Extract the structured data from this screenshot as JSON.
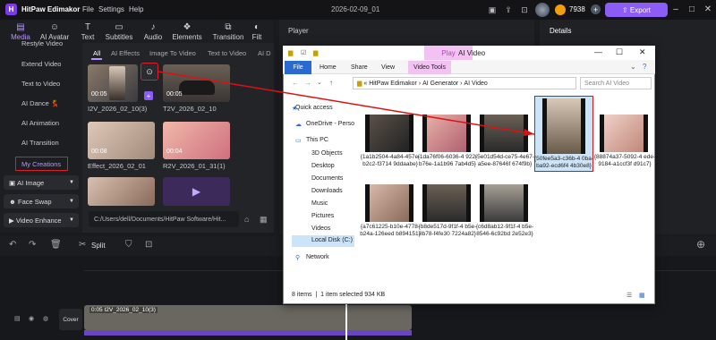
{
  "app": {
    "name": "HitPaw Edimakor",
    "menus": [
      "File",
      "Settings",
      "Help"
    ],
    "project": "2026-02-09_01",
    "coins": "7938",
    "export_label": "Export",
    "accent": "#8b5cf6"
  },
  "toolbar": {
    "items": [
      {
        "label": "Media",
        "icon": "media-icon"
      },
      {
        "label": "AI Avatar",
        "icon": "ai-avatar-icon"
      },
      {
        "label": "Text",
        "icon": "text-icon"
      },
      {
        "label": "Subtitles",
        "icon": "subtitles-icon"
      },
      {
        "label": "Audio",
        "icon": "audio-icon"
      },
      {
        "label": "Elements",
        "icon": "elements-icon"
      },
      {
        "label": "Transition",
        "icon": "transition-icon"
      },
      {
        "label": "Filt",
        "icon": "filter-icon"
      }
    ]
  },
  "sidebar": {
    "items": [
      "Restyle Video",
      "Extend Video",
      "Text to Video",
      "AI Dance 💃",
      "AI Animation",
      "AI Transition",
      "My Creations"
    ],
    "groups": [
      "AI Image",
      "Face Swap",
      "Video Enhance"
    ]
  },
  "media": {
    "filters": [
      "All",
      "AI Effects",
      "Image To Video",
      "Text to Video",
      "AI D"
    ],
    "items": [
      {
        "name": "I2V_2026_02_10(3)",
        "duration": "00:05"
      },
      {
        "name": "T2V_2026_02_10",
        "duration": "00:05"
      },
      {
        "name": "Effect_2026_02_01",
        "duration": "00:08"
      },
      {
        "name": "R2V_2026_01_31(1)",
        "duration": "00:04"
      }
    ],
    "path": "C:/Users/dell/Documents/HitPaw Software/Hit..."
  },
  "player": {
    "title": "Player"
  },
  "details": {
    "title": "Details"
  },
  "timeline": {
    "split_label": "Split",
    "cover_label": "Cover",
    "clip_label": "0:05 I2V_2026_02_10(3)"
  },
  "explorer": {
    "tab_play": "Play",
    "title": "AI Video",
    "ribbon": [
      "File",
      "Home",
      "Share",
      "View",
      "Video Tools"
    ],
    "address": [
      "«",
      "HitPaw Edimakor",
      "AI Generator",
      "AI Video"
    ],
    "search_placeholder": "Search AI Video",
    "nav": [
      "Quick access",
      "OneDrive - Perso",
      "This PC",
      "3D Objects",
      "Desktop",
      "Documents",
      "Downloads",
      "Music",
      "Pictures",
      "Videos",
      "Local Disk (C:)",
      "Network"
    ],
    "files": [
      {
        "name": "{1a1b2504-4a84-457e-b2c2-f3714 9ddaabe}"
      },
      {
        "name": "{1da76f06-6036-4 922-b76e-1a1b96 7ab4d5}"
      },
      {
        "name": "{5e01d54d-ce75-4e67-a5ee-87646f 674f9b}"
      },
      {
        "name": "{50fee5a3-c36b-4 0ba-ba92-ecd6f4 4b30e8}"
      },
      {
        "name": "{88874a37-5092-4 ede-9184-a1ccf3f d91c7}"
      },
      {
        "name": "{a7c61225-b10e-4778-b24a-126eed b894151}"
      },
      {
        "name": "{b8de517d-9f1f-4 b5e-8b78-f4fe30 7224a82}"
      },
      {
        "name": "{c6d8ab12-9f1f-4 b5e-8546-6c92bd 2e52e3}"
      }
    ],
    "status_items": "8 items",
    "status_selected": "1 item selected  934 KB"
  }
}
